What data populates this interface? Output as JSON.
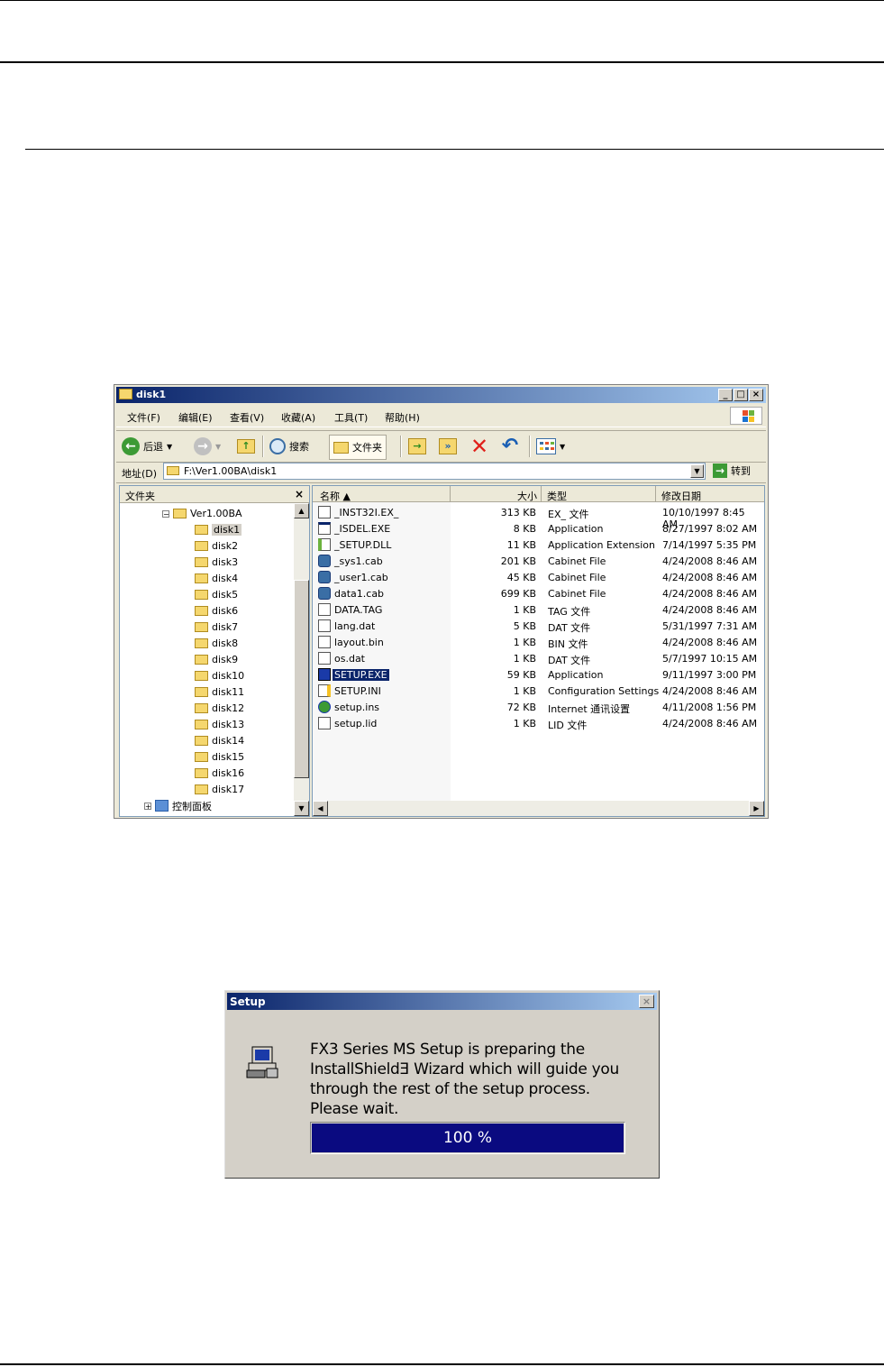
{
  "explorer": {
    "title": "disk1",
    "window_buttons": [
      "_",
      "□",
      "×"
    ],
    "menu": [
      "文件(F)",
      "编辑(E)",
      "查看(V)",
      "收藏(A)",
      "工具(T)",
      "帮助(H)"
    ],
    "toolbar": {
      "back": "后退",
      "search": "搜索",
      "folders": "文件夹"
    },
    "address": {
      "label": "地址(D)",
      "value": "F:\\Ver1.00BA\\disk1",
      "go": "转到"
    },
    "folder_pane": {
      "title": "文件夹",
      "close": "×",
      "root": "Ver1.00BA",
      "disks": [
        "disk1",
        "disk2",
        "disk3",
        "disk4",
        "disk5",
        "disk6",
        "disk7",
        "disk8",
        "disk9",
        "disk10",
        "disk11",
        "disk12",
        "disk13",
        "disk14",
        "disk15",
        "disk16",
        "disk17"
      ],
      "control_panel": "控制面板"
    },
    "columns": {
      "name": "名称 ▲",
      "size": "大小",
      "type": "类型",
      "modified": "修改日期"
    },
    "files": [
      {
        "name": "_INST32I.EX_",
        "size": "313 KB",
        "type": "EX_ 文件",
        "date": "10/10/1997 8:45 AM",
        "icon": "generic-file-icon"
      },
      {
        "name": "_ISDEL.EXE",
        "size": "8 KB",
        "type": "Application",
        "date": "8/27/1997 8:02 AM",
        "icon": "application-icon"
      },
      {
        "name": "_SETUP.DLL",
        "size": "11 KB",
        "type": "Application Extension",
        "date": "7/14/1997 5:35 PM",
        "icon": "dll-icon"
      },
      {
        "name": "_sys1.cab",
        "size": "201 KB",
        "type": "Cabinet File",
        "date": "4/24/2008 8:46 AM",
        "icon": "cabinet-icon"
      },
      {
        "name": "_user1.cab",
        "size": "45 KB",
        "type": "Cabinet File",
        "date": "4/24/2008 8:46 AM",
        "icon": "cabinet-icon"
      },
      {
        "name": "data1.cab",
        "size": "699 KB",
        "type": "Cabinet File",
        "date": "4/24/2008 8:46 AM",
        "icon": "cabinet-icon"
      },
      {
        "name": "DATA.TAG",
        "size": "1 KB",
        "type": "TAG 文件",
        "date": "4/24/2008 8:46 AM",
        "icon": "generic-file-icon"
      },
      {
        "name": "lang.dat",
        "size": "5 KB",
        "type": "DAT 文件",
        "date": "5/31/1997 7:31 AM",
        "icon": "generic-file-icon"
      },
      {
        "name": "layout.bin",
        "size": "1 KB",
        "type": "BIN 文件",
        "date": "4/24/2008 8:46 AM",
        "icon": "generic-file-icon"
      },
      {
        "name": "os.dat",
        "size": "1 KB",
        "type": "DAT 文件",
        "date": "5/7/1997 10:15 AM",
        "icon": "generic-file-icon"
      },
      {
        "name": "SETUP.EXE",
        "size": "59 KB",
        "type": "Application",
        "date": "9/11/1997 3:00 PM",
        "icon": "setup-exe-icon"
      },
      {
        "name": "SETUP.INI",
        "size": "1 KB",
        "type": "Configuration Settings",
        "date": "4/24/2008 8:46 AM",
        "icon": "ini-file-icon"
      },
      {
        "name": "setup.ins",
        "size": "72 KB",
        "type": "Internet 通讯设置",
        "date": "4/11/2008 1:56 PM",
        "icon": "internet-settings-icon"
      },
      {
        "name": "setup.lid",
        "size": "1 KB",
        "type": "LID 文件",
        "date": "4/24/2008 8:46 AM",
        "icon": "generic-file-icon"
      }
    ],
    "selected_file": "SETUP.EXE",
    "selected_folder": "disk1"
  },
  "setup_dialog": {
    "title": "Setup",
    "close": "×",
    "message_lines": [
      "FX3 Series MS Setup is preparing the",
      "InstallShieldƎ Wizard which will guide you",
      "through the rest of the setup process.",
      "Please wait."
    ],
    "progress_text": "100 %",
    "progress_fraction": 1.0
  }
}
